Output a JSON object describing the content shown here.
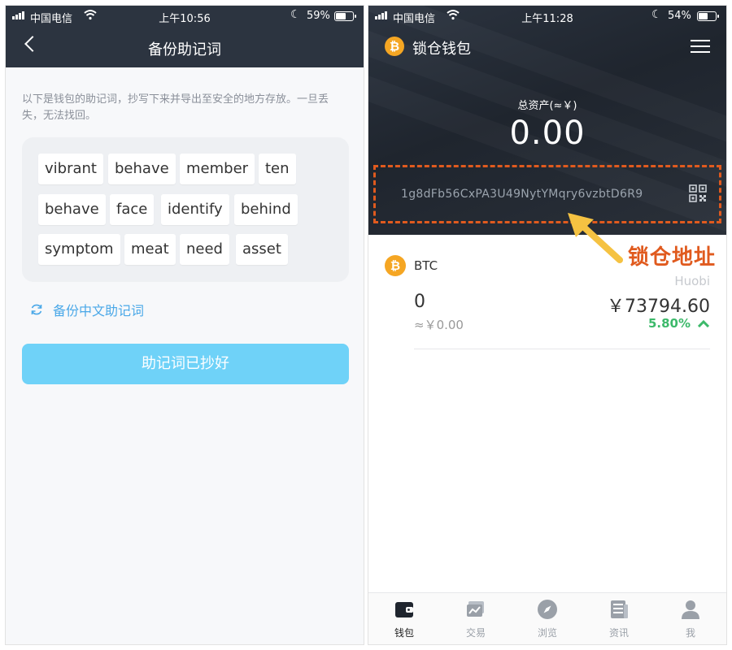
{
  "left": {
    "status": {
      "carrier": "中国电信",
      "time": "上午10:56",
      "battery": "59%"
    },
    "title": "备份助记词",
    "description": "以下是钱包的助记词，抄写下来并导出至安全的地方存放。一旦丢失，无法找回。",
    "words": [
      "vibrant",
      "behave",
      "member",
      "ten",
      "behave",
      "face",
      "identify",
      "behind",
      "symptom",
      "meat",
      "need",
      "asset"
    ],
    "alt_link": "备份中文助记词",
    "confirm_button": "助记词已抄好",
    "colors": {
      "header": "#2c3440",
      "button": "#6fd2f8",
      "link": "#4aa8e8"
    }
  },
  "right": {
    "status": {
      "carrier": "中国电信",
      "time": "上午11:28",
      "battery": "54%"
    },
    "app_title": "锁仓钱包",
    "total_label": "总资产(≈￥)",
    "total_value": "0.00",
    "address": "1g8dFb56CxPA3U49NytYMqry6vzbtD6R9",
    "asset": {
      "symbol": "BTC",
      "exchange": "Huobi",
      "amount": "0",
      "price": "￥73794.60",
      "approx_value": "≈￥0.00",
      "change": "5.80%"
    },
    "tabs": [
      "钱包",
      "交易",
      "浏览",
      "资讯",
      "我"
    ],
    "annotation": "锁仓地址",
    "colors": {
      "accent": "#f5a623",
      "up": "#3cb96a",
      "annotation": "#e05a1e"
    }
  }
}
